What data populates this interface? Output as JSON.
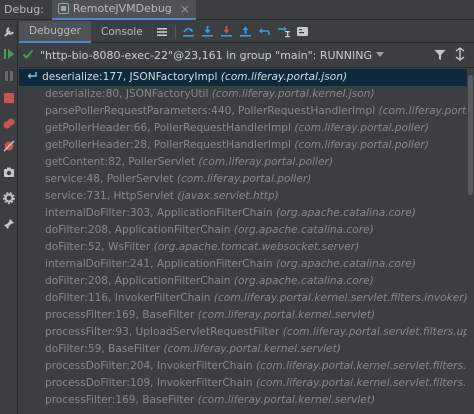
{
  "titlebar": {
    "debug_label": "Debug:",
    "run_config_tab": "RemoteJVMDebug",
    "close_glyph": "×"
  },
  "toolbar": {
    "tabs": [
      {
        "label": "Debugger",
        "active": true
      },
      {
        "label": "Console",
        "active": false
      }
    ],
    "icons": [
      "menu-icon",
      "step-over-icon",
      "step-into-icon",
      "force-step-into-icon",
      "step-out-icon",
      "drop-frame-icon",
      "run-to-cursor-icon",
      "evaluate-icon"
    ]
  },
  "thread": {
    "label": "\"http-bio-8080-exec-22\"@23,161 in group \"main\": RUNNING"
  },
  "frames": [
    {
      "method": "deserialize:177, JSONFactoryImpl",
      "pkg": "(com.liferay.portal.json)",
      "selected": true
    },
    {
      "method": "deserialize:80, JSONFactoryUtil",
      "pkg": "(com.liferay.portal.kernel.json)"
    },
    {
      "method": "parsePollerRequestParameters:440, PollerRequestHandlerImpl",
      "pkg": "(com.liferay.portal.poller)"
    },
    {
      "method": "getPollerHeader:66, PollerRequestHandlerImpl",
      "pkg": "(com.liferay.portal.poller)"
    },
    {
      "method": "getPollerHeader:28, PollerRequestHandlerImpl",
      "pkg": "(com.liferay.portal.poller)"
    },
    {
      "method": "getContent:82, PollerServlet",
      "pkg": "(com.liferay.portal.poller)"
    },
    {
      "method": "service:48, PollerServlet",
      "pkg": "(com.liferay.portal.poller)"
    },
    {
      "method": "service:731, HttpServlet",
      "pkg": "(javax.servlet.http)"
    },
    {
      "method": "internalDoFilter:303, ApplicationFilterChain",
      "pkg": "(org.apache.catalina.core)"
    },
    {
      "method": "doFilter:208, ApplicationFilterChain",
      "pkg": "(org.apache.catalina.core)"
    },
    {
      "method": "doFilter:52, WsFilter",
      "pkg": "(org.apache.tomcat.websocket.server)"
    },
    {
      "method": "internalDoFilter:241, ApplicationFilterChain",
      "pkg": "(org.apache.catalina.core)"
    },
    {
      "method": "doFilter:208, ApplicationFilterChain",
      "pkg": "(org.apache.catalina.core)"
    },
    {
      "method": "doFilter:116, InvokerFilterChain",
      "pkg": "(com.liferay.portal.kernel.servlet.filters.invoker)"
    },
    {
      "method": "processFilter:169, BaseFilter",
      "pkg": "(com.liferay.portal.kernel.servlet)"
    },
    {
      "method": "processFilter:93, UploadServletRequestFilter",
      "pkg": "(com.liferay.portal.servlet.filters.uploadservletrequest)"
    },
    {
      "method": "doFilter:59, BaseFilter",
      "pkg": "(com.liferay.portal.kernel.servlet)"
    },
    {
      "method": "processDoFilter:204, InvokerFilterChain",
      "pkg": "(com.liferay.portal.kernel.servlet.filters.invoker)"
    },
    {
      "method": "processDoFilter:109, InvokerFilterChain",
      "pkg": "(com.liferay.portal.kernel.servlet.filters.invoker)"
    },
    {
      "method": "processFilter:169, BaseFilter",
      "pkg": "(com.liferay.portal.kernel.servlet)"
    }
  ],
  "colors": {
    "background": "#3c3f41",
    "selection": "#0d293e",
    "accent": "#4a88c7",
    "run_green": "#499c54",
    "stop_red": "#c75450"
  }
}
